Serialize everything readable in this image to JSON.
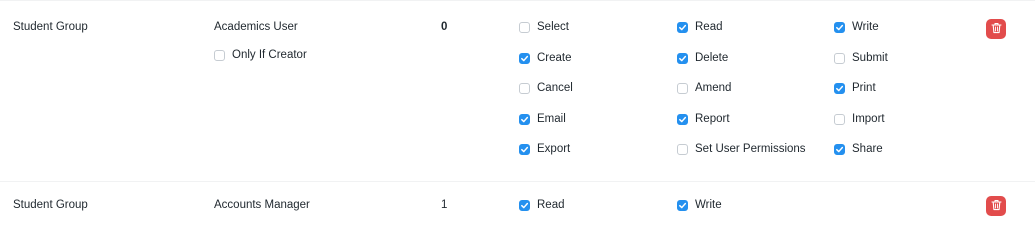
{
  "rows": [
    {
      "document_type": "Student Group",
      "role": "Academics User",
      "level": "0",
      "only_if_creator": {
        "label": "Only If Creator",
        "checked": false
      },
      "permissions": [
        {
          "label": "Select",
          "checked": false
        },
        {
          "label": "Read",
          "checked": true
        },
        {
          "label": "Write",
          "checked": true
        },
        {
          "label": "Create",
          "checked": true
        },
        {
          "label": "Delete",
          "checked": true
        },
        {
          "label": "Submit",
          "checked": false
        },
        {
          "label": "Cancel",
          "checked": false
        },
        {
          "label": "Amend",
          "checked": false
        },
        {
          "label": "Print",
          "checked": true
        },
        {
          "label": "Email",
          "checked": true
        },
        {
          "label": "Report",
          "checked": true
        },
        {
          "label": "Import",
          "checked": false
        },
        {
          "label": "Export",
          "checked": true
        },
        {
          "label": "Set User Permissions",
          "checked": false
        },
        {
          "label": "Share",
          "checked": true
        }
      ],
      "delete_icon": "trash-icon"
    },
    {
      "document_type": "Student Group",
      "role": "Accounts Manager",
      "level": "1",
      "permissions": [
        {
          "label": "Read",
          "checked": true
        },
        {
          "label": "Write",
          "checked": true
        }
      ],
      "delete_icon": "trash-icon"
    }
  ],
  "colors": {
    "checkbox_checked": "#2490ef",
    "delete_button": "#e24c4c",
    "text": "#1f272e"
  }
}
